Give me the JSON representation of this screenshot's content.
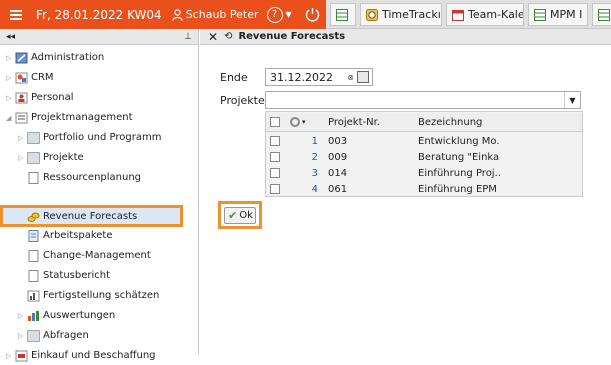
{
  "topbar": {
    "date": "Fr, 28.01.2022 KW04",
    "user": "Schaub Peter",
    "help": "?",
    "tabs": [
      {
        "label": "",
        "icon": "grid-icon"
      },
      {
        "label": "TimeTrackı",
        "icon": "clock-icon"
      },
      {
        "label": "Team-Kale",
        "icon": "calendar-icon"
      },
      {
        "label": "MPM I",
        "icon": "grid-icon"
      },
      {
        "label": "",
        "icon": "grid-icon"
      }
    ]
  },
  "sidebar": {
    "collapse": "◂◂",
    "pin": "⊥",
    "items": [
      {
        "label": "Administration"
      },
      {
        "label": "CRM"
      },
      {
        "label": "Personal"
      },
      {
        "label": "Projektmanagement"
      },
      {
        "label": "Portfolio und Programm"
      },
      {
        "label": "Projekte"
      },
      {
        "label": "Ressourcenplanung"
      },
      {
        "label": "Revenue Forecasts"
      },
      {
        "label": "Arbeitspakete"
      },
      {
        "label": "Change-Management"
      },
      {
        "label": "Statusbericht"
      },
      {
        "label": "Fertigstellung schätzen"
      },
      {
        "label": "Auswertungen"
      },
      {
        "label": "Abfragen"
      },
      {
        "label": "Einkauf und Beschaffung"
      }
    ]
  },
  "main": {
    "title": "Revenue Forecasts",
    "end_label": "Ende",
    "end_value": "31.12.2022",
    "projects_label": "Projekte",
    "grid": {
      "headers": [
        "Projekt-Nr.",
        "Bezeichnung"
      ],
      "rows": [
        {
          "idx": "1",
          "nr": "003",
          "name": "Entwicklung Mo..."
        },
        {
          "idx": "2",
          "nr": "009",
          "name": "Beratung \"Einka..."
        },
        {
          "idx": "3",
          "nr": "014",
          "name": "Einführung Proj..."
        },
        {
          "idx": "4",
          "nr": "061",
          "name": "Einführung EPM"
        }
      ]
    },
    "ok_label": "Ok"
  },
  "colors": {
    "brand": "#e9501b",
    "highlight": "#f08f2c"
  }
}
